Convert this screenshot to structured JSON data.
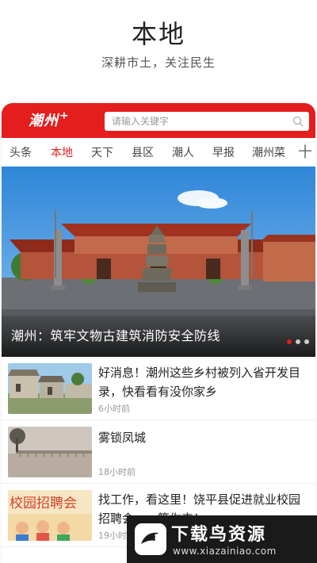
{
  "promo": {
    "title": "本地",
    "subtitle": "深耕市土，关注民生"
  },
  "app": {
    "logo_text": "潮州",
    "logo_plus": "+",
    "brand_color": "#e41d1d",
    "search_placeholder": "请输入关键字",
    "search_icon": "search-icon"
  },
  "tabs": {
    "items": [
      "头条",
      "本地",
      "天下",
      "县区",
      "潮人",
      "早报",
      "潮州菜"
    ],
    "active_index": 1,
    "more_label": "十"
  },
  "banner": {
    "title": "潮州：筑牢文物古建筑消防安全防线",
    "dots_count": 3,
    "active_dot": 0
  },
  "news": [
    {
      "title": "好消息！潮州这些乡村被列入省开发目录，快看看有没你家乡",
      "time": "6小时前"
    },
    {
      "title": "雾锁凤城",
      "time": "18小时前"
    },
    {
      "title": "找工作，看这里！饶平县促进就业校园招聘会……等你来！",
      "time": "19小时前"
    }
  ],
  "thumb3_text": "校园招聘会",
  "watermark": {
    "title": "下载鸟资源",
    "url": "www.xiazainiao.com"
  }
}
